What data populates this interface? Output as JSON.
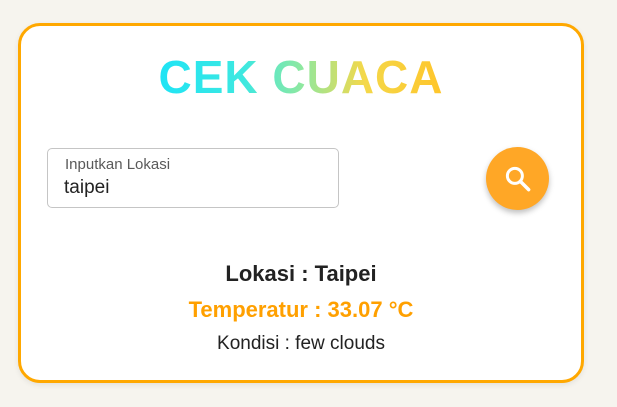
{
  "header": {
    "title": "CEK CUACA"
  },
  "search": {
    "label": "Inputkan Lokasi",
    "value": "taipei",
    "button_icon": "search-icon"
  },
  "result": {
    "location": "Lokasi : Taipei",
    "temperature": "Temperatur : 33.07 °C",
    "condition": "Kondisi : few clouds"
  },
  "colors": {
    "accent": "#ffa800",
    "button": "#ffa726",
    "temperature_text": "#ffa000",
    "title_gradient": [
      "#1fe4f5",
      "#8ee8a0",
      "#ffc52b"
    ]
  }
}
